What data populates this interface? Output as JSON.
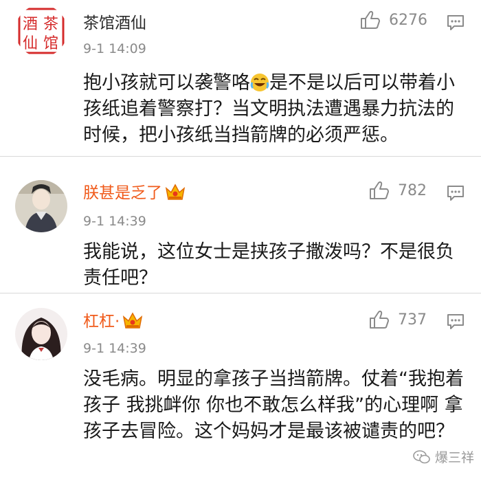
{
  "comments": [
    {
      "username": "茶馆酒仙",
      "time": "9-1 14:09",
      "likes": "6276",
      "text_before_emoji": "抱小孩就可以袭警咯",
      "text_after_emoji": "是不是以后可以带着小孩纸追着警察打？当文明执法遭遇暴力抗法的时候，把小孩纸当挡箭牌的必须严惩。",
      "avatar_seal_text": [
        "酒",
        "茶",
        "仙",
        "馆"
      ]
    },
    {
      "username": "朕甚是乏了",
      "time": "9-1 14:39",
      "likes": "782",
      "text": "我能说，这位女士是挟孩子撒泼吗？不是很负责任吧？"
    },
    {
      "username": "杠杠·",
      "time": "9-1 14:39",
      "likes": "737",
      "text": "没毛病。明显的拿孩子当挡箭牌。仗着“我抱着孩子 我挑衅你 你也不敢怎么样我”的心理啊 拿孩子去冒险。这个妈妈才是最该被谴责的吧？"
    }
  ],
  "watermark": "爆三祥",
  "icons": [
    "thumb-up-icon",
    "comment-icon",
    "vip-crown-icon",
    "laughing-emoji-icon",
    "wechat-icon"
  ],
  "colors": {
    "vip_name": "#f05a1a",
    "meta": "#8a8a8a",
    "seal_red": "#d52b2b"
  }
}
